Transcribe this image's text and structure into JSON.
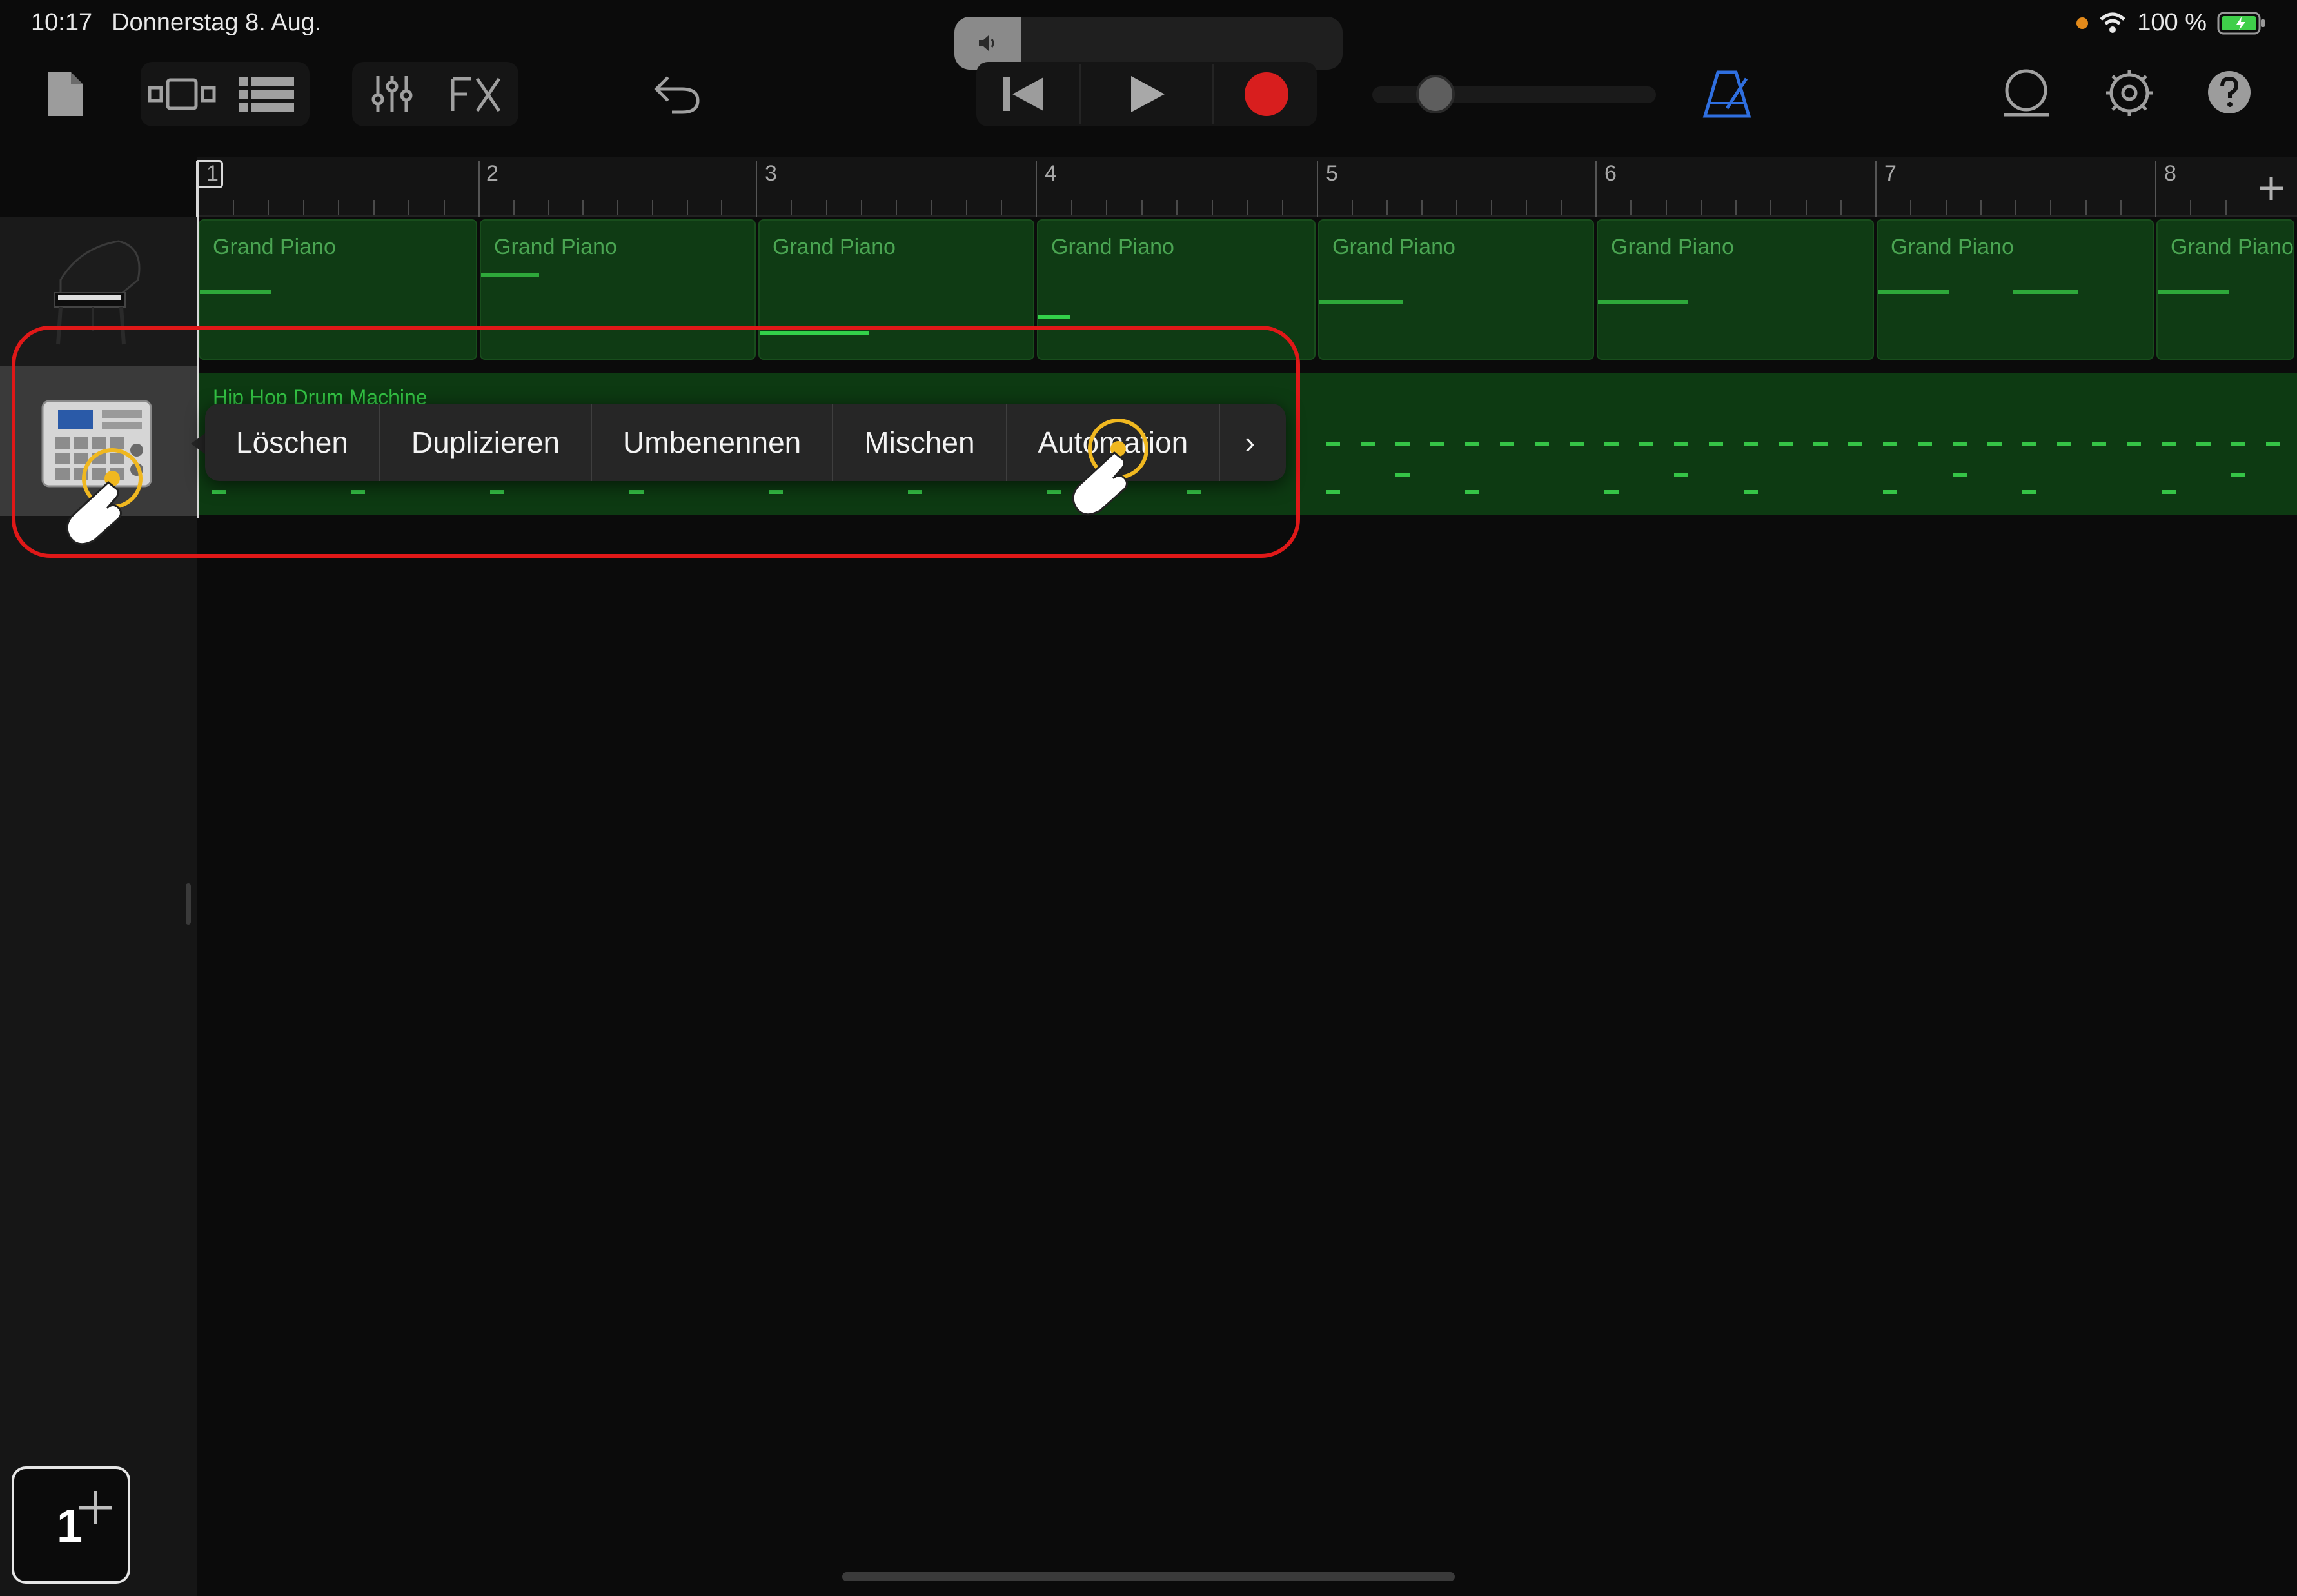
{
  "status_bar": {
    "time": "10:17",
    "date": "Donnerstag 8. Aug.",
    "battery": "100 %"
  },
  "ruler": {
    "bars": [
      "1",
      "2",
      "3",
      "4",
      "5",
      "6",
      "7",
      "8"
    ]
  },
  "tracks": {
    "piano": {
      "region_label": "Grand Piano"
    },
    "drum": {
      "region_label": "Hip Hop Drum Machine"
    }
  },
  "context_menu": {
    "items": [
      "Löschen",
      "Duplizieren",
      "Umbenennen",
      "Mischen",
      "Automation"
    ],
    "more": "›"
  },
  "add_track": {
    "badge": "1"
  },
  "colors": {
    "accent": "#e01818",
    "region": "#0f3b14",
    "notes": "#33d14a",
    "record": "#d81e1e",
    "metronome": "#2f6fe0"
  }
}
